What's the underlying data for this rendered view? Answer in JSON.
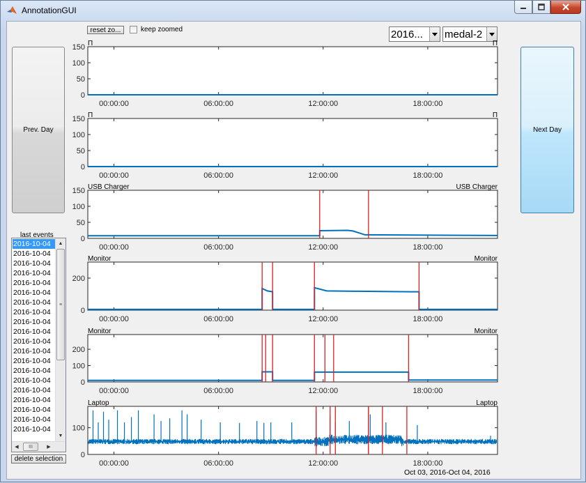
{
  "window": {
    "title": "AnnotationGUI"
  },
  "toolbar": {
    "reset_zoom_label": "reset zo...",
    "keep_zoomed_label": "keep zoomed",
    "keep_zoomed_checked": false
  },
  "selectors": {
    "date_value": "2016...",
    "device_value": "medal-2"
  },
  "buttons": {
    "prev_day_label": "Prev. Day",
    "next_day_label": "Next Day",
    "delete_selection_label": "delete selection"
  },
  "events": {
    "label": "last events",
    "items": [
      "2016-10-04",
      "2016-10-04",
      "2016-10-04",
      "2016-10-04",
      "2016-10-04",
      "2016-10-04",
      "2016-10-04",
      "2016-10-04",
      "2016-10-04",
      "2016-10-04",
      "2016-10-04",
      "2016-10-04",
      "2016-10-04",
      "2016-10-04",
      "2016-10-04",
      "2016-10-04",
      "2016-10-04",
      "2016-10-04",
      "2016-10-04",
      "2016-10-04"
    ],
    "selected_index": 0,
    "hscroll_thumb_label": "III"
  },
  "date_range": "Oct 03, 2016-Oct 04, 2016",
  "colors": {
    "signal": "#0072bd",
    "event_marker": "#e02020",
    "next_button": "#bee6fd"
  },
  "chart_data": [
    {
      "type": "line",
      "title_left": "П",
      "title_right": "П",
      "xticks": [
        "00:00:00",
        "06:00:00",
        "12:00:00",
        "18:00:00"
      ],
      "yticks": [
        "0",
        "50",
        "100",
        "150"
      ],
      "ylim": [
        0,
        150
      ],
      "xlim_hours": [
        -1.5,
        22
      ],
      "series": [
        {
          "x": [
            -1.5,
            22
          ],
          "y": [
            0,
            0
          ]
        }
      ],
      "events_hours": []
    },
    {
      "type": "line",
      "title_left": "П",
      "title_right": "П",
      "xticks": [
        "00:00:00",
        "06:00:00",
        "12:00:00",
        "18:00:00"
      ],
      "yticks": [
        "0",
        "50",
        "100",
        "150"
      ],
      "ylim": [
        0,
        150
      ],
      "xlim_hours": [
        -1.5,
        22
      ],
      "series": [
        {
          "x": [
            -1.5,
            22
          ],
          "y": [
            0,
            0
          ]
        }
      ],
      "events_hours": []
    },
    {
      "type": "line",
      "title_left": "USB Charger",
      "title_right": "USB Charger",
      "xticks": [
        "00:00:00",
        "06:00:00",
        "12:00:00",
        "18:00:00"
      ],
      "yticks": [
        "0",
        "50",
        "100",
        "150"
      ],
      "ylim": [
        0,
        150
      ],
      "xlim_hours": [
        -1.5,
        22
      ],
      "series": [
        {
          "x": [
            -1.5,
            11.8,
            11.8,
            13.4,
            13.7,
            14,
            14.4,
            22
          ],
          "y": [
            8,
            8,
            24,
            25,
            23,
            18,
            11,
            9
          ]
        }
      ],
      "events_hours": [
        11.8,
        14.6
      ]
    },
    {
      "type": "line",
      "title_left": "Monitor",
      "title_right": "Monitor",
      "xticks": [
        "00:00:00",
        "06:00:00",
        "12:00:00",
        "18:00:00"
      ],
      "yticks": [
        "0",
        "200"
      ],
      "ylim": [
        0,
        300
      ],
      "xlim_hours": [
        -1.5,
        22
      ],
      "series": [
        {
          "x": [
            -1.5,
            8.5,
            8.5,
            8.8,
            9.1,
            9.1,
            11.5,
            11.5,
            12.2,
            14,
            17,
            17.5,
            17.5,
            22
          ],
          "y": [
            5,
            5,
            135,
            120,
            115,
            5,
            5,
            140,
            120,
            118,
            115,
            115,
            5,
            5
          ]
        }
      ],
      "events_hours": [
        8.5,
        9.1,
        11.5,
        17.5
      ]
    },
    {
      "type": "line",
      "title_left": "Monitor",
      "title_right": "Monitor",
      "xticks": [
        "00:00:00",
        "06:00:00",
        "12:00:00",
        "18:00:00"
      ],
      "yticks": [
        "0",
        "100",
        "200"
      ],
      "ylim": [
        0,
        290
      ],
      "xlim_hours": [
        -1.5,
        22
      ],
      "series": [
        {
          "x": [
            -1.5,
            8.5,
            8.5,
            9.1,
            9.1,
            11.5,
            11.5,
            16.9,
            16.9,
            22
          ],
          "y": [
            10,
            10,
            62,
            62,
            10,
            10,
            60,
            60,
            12,
            12
          ]
        }
      ],
      "events_hours": [
        8.5,
        8.7,
        9.1,
        11.5,
        12.1,
        12.6,
        16.9
      ]
    },
    {
      "type": "line",
      "title_left": "Laptop",
      "title_right": "Laptop",
      "xticks": [
        "00:00:00",
        "06:00:00",
        "12:00:00",
        "18:00:00"
      ],
      "yticks": [
        "0",
        "100"
      ],
      "ylim": [
        0,
        180
      ],
      "xlim_hours": [
        -1.5,
        22
      ],
      "series": [
        {
          "baseline": 48,
          "noise": 10,
          "spikes": [
            [
              -1.2,
              165
            ],
            [
              -0.9,
              120
            ],
            [
              -0.6,
              160
            ],
            [
              -0.3,
              130
            ],
            [
              0.2,
              165
            ],
            [
              0.6,
              120
            ],
            [
              1.0,
              140
            ],
            [
              1.4,
              165
            ],
            [
              2.3,
              150
            ],
            [
              2.7,
              125
            ],
            [
              3.2,
              135
            ],
            [
              3.9,
              165
            ],
            [
              4.2,
              150
            ],
            [
              5.0,
              130
            ],
            [
              6.1,
              120
            ],
            [
              7.2,
              118
            ],
            [
              8.2,
              125
            ],
            [
              8.6,
              118
            ],
            [
              9.0,
              120
            ],
            [
              10.2,
              120
            ],
            [
              11.6,
              160
            ],
            [
              12.4,
              140
            ],
            [
              12.7,
              120
            ],
            [
              13.5,
              125
            ],
            [
              14.7,
              150
            ],
            [
              15.6,
              120
            ],
            [
              17.4,
              110
            ],
            [
              21.6,
              70
            ]
          ]
        }
      ],
      "events_hours": [
        11.6,
        12.4,
        12.7,
        14.6,
        14.6,
        15.4,
        16.8
      ]
    }
  ]
}
